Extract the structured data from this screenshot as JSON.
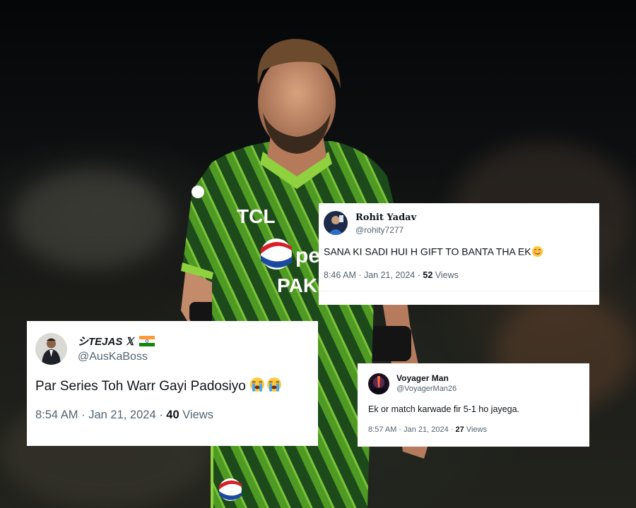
{
  "background": {
    "jersey_sponsor": "TCL",
    "jersey_text": "PAKIS",
    "jersey_brand": "pe",
    "colors": {
      "jersey_dark": "#1e4a1c",
      "jersey_light": "#6fb52c"
    }
  },
  "tweets": [
    {
      "name": "Rohit Yadav",
      "handle": "@rohity7277",
      "text": "SANA KI SADI HUI H GIFT TO BANTA THA EK",
      "emoji": "smiling-face-icon",
      "time": "8:46 AM · Jan 21, 2024 · ",
      "views_count": "52",
      "views_label": " Views"
    },
    {
      "name": "シTEJAS 𝕏",
      "flag": "india-flag-icon",
      "handle": "@AusKaBoss",
      "text": "Par Series Toh Warr Gayi Padosiyo ",
      "emoji": "crying-face-icon",
      "time": "8:54 AM · Jan 21, 2024 · ",
      "views_count": "40",
      "views_label": " Views"
    },
    {
      "name": "Voyager Man",
      "handle": "@VoyagerMan26",
      "text": "Ek or match karwade fir 5-1 ho jayega.",
      "time": "8:57 AM · Jan 21, 2024 · ",
      "views_count": "27",
      "views_label": " Views"
    }
  ]
}
